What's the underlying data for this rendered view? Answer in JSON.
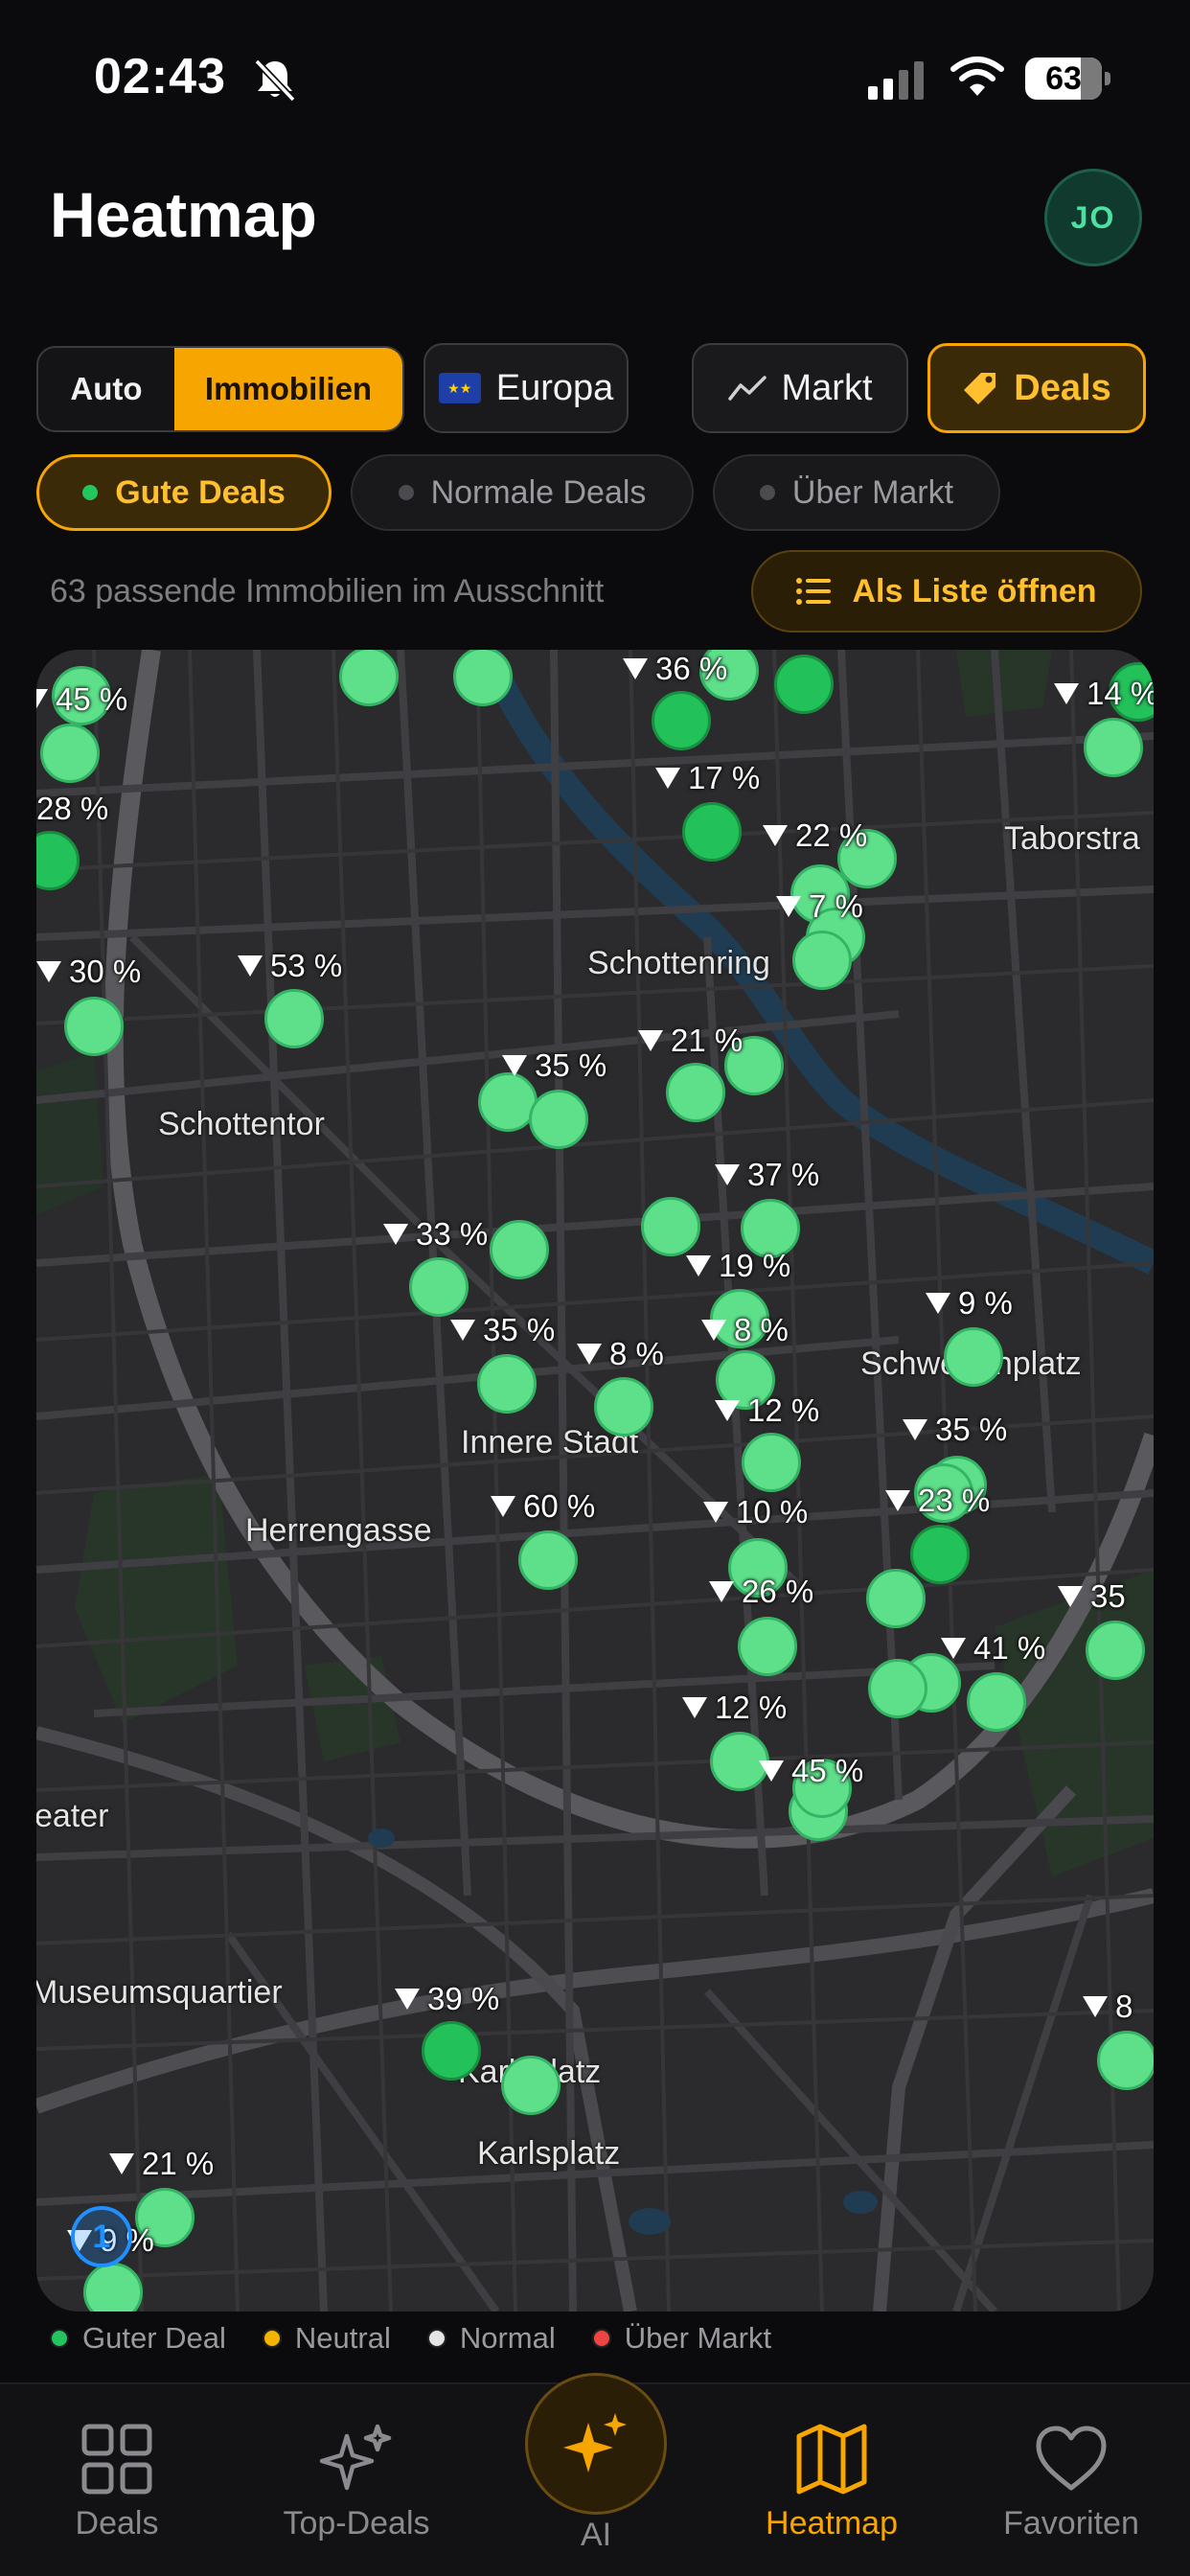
{
  "status_bar": {
    "time": "02:43",
    "battery": "63"
  },
  "header": {
    "title": "Heatmap",
    "avatar_initials": "JO"
  },
  "filters": {
    "mode_auto": "Auto",
    "mode_immobilien": "Immobilien",
    "region": "Europa",
    "markt": "Markt",
    "deals": "Deals",
    "deal_chips": [
      {
        "label": "Gute Deals",
        "active": true
      },
      {
        "label": "Normale Deals",
        "active": false
      },
      {
        "label": "Über Markt",
        "active": false
      }
    ]
  },
  "results": {
    "count_text": "63 passende Immobilien im Ausschnitt",
    "list_button": "Als Liste öffnen"
  },
  "map": {
    "place_labels": [
      "Taborstra",
      "Schottenring",
      "Schottentor",
      "Schwedenplatz",
      "Innere Stadt",
      "Herrengasse",
      "eater",
      "Museumsquartier",
      "Karlsplatz",
      "Karlsplatz"
    ],
    "deal_labels": [
      "45 %",
      "28 %",
      "30 %",
      "53 %",
      "36 %",
      "17 %",
      "22 %",
      "7 %",
      "14 %",
      "35 %",
      "21 %",
      "37 %",
      "33 %",
      "19 %",
      "35 %",
      "8 %",
      "8 %",
      "9 %",
      "12 %",
      "35 %",
      "60 %",
      "10 %",
      "23 %",
      "26 %",
      "35",
      "41 %",
      "12 %",
      "45 %",
      "39 %",
      "8",
      "21 %",
      "9 %"
    ],
    "cluster_count": "1"
  },
  "legend": [
    {
      "label": "Guter Deal",
      "color": "#22c55e"
    },
    {
      "label": "Neutral",
      "color": "#f5b400"
    },
    {
      "label": "Normal",
      "color": "#e5e5e5"
    },
    {
      "label": "Über Markt",
      "color": "#ef4444"
    }
  ],
  "tabs": [
    {
      "label": "Deals",
      "icon": "grid-icon"
    },
    {
      "label": "Top-Deals",
      "icon": "sparkles-icon"
    },
    {
      "label": "AI",
      "icon": "ai-sparkles-icon"
    },
    {
      "label": "Heatmap",
      "icon": "map-icon",
      "active": true
    },
    {
      "label": "Favoriten",
      "icon": "heart-icon"
    }
  ],
  "colors": {
    "accent": "#f7a500",
    "deal_green": "#5ee08a",
    "background": "#0b0b0d"
  }
}
